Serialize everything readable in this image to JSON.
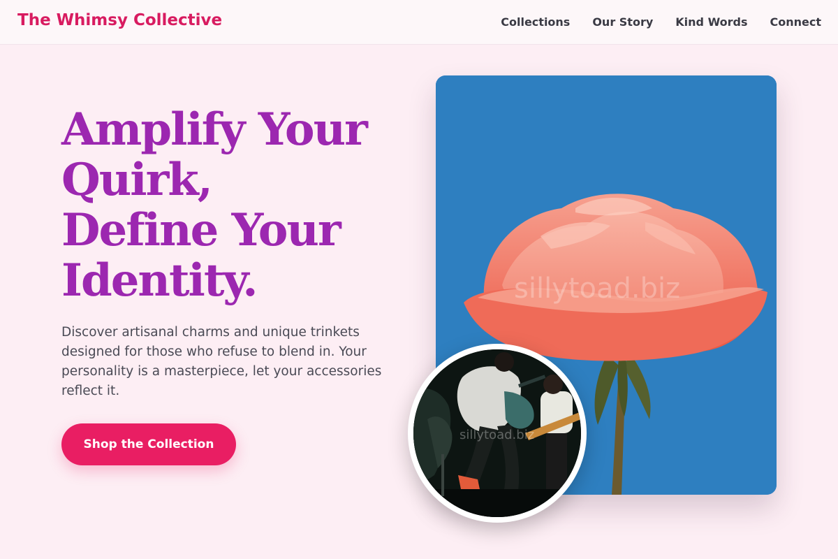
{
  "brand": {
    "name": "The Whimsy Collective"
  },
  "nav": {
    "links": [
      "Collections",
      "Our Story",
      "Kind Words",
      "Connect"
    ]
  },
  "hero": {
    "title_lines": [
      "Amplify Your",
      "Quirk,",
      "Define Your",
      "Identity."
    ],
    "description": "Discover artisanal charms and unique trinkets designed for those who refuse to blend in. Your personality is a masterpiece, let your accessories reflect it.",
    "cta_label": "Shop the Collection"
  },
  "images": {
    "main_watermark": "sillytoad.biz",
    "circle_watermark": "sillytoad.biz"
  },
  "colors": {
    "brand": "#d81b60",
    "title": "#9c27b0",
    "cta": "#e91e63",
    "page_background": "#fdeef4",
    "image_sky": "#2e7fc0",
    "rose": "#f07462"
  }
}
